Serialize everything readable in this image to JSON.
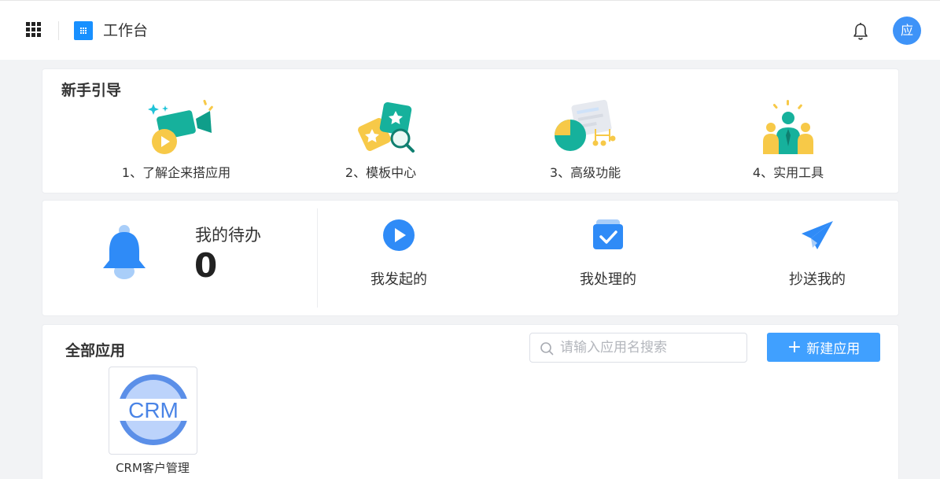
{
  "topbar": {
    "title": "工作台",
    "avatar_text": "应",
    "icons": [
      "apps-grid-icon",
      "workspace-logo-icon",
      "notification-bell-icon"
    ]
  },
  "guide": {
    "title": "新手引导",
    "items": [
      {
        "label": "1、了解企来搭应用",
        "icon": "video-camera-illustration"
      },
      {
        "label": "2、模板中心",
        "icon": "template-cards-illustration"
      },
      {
        "label": "3、高级功能",
        "icon": "chart-flow-illustration"
      },
      {
        "label": "4、实用工具",
        "icon": "team-people-illustration"
      }
    ]
  },
  "todo": {
    "title": "我的待办",
    "count": "0",
    "actions": [
      {
        "label": "我发起的",
        "icon": "play-circle-icon"
      },
      {
        "label": "我处理的",
        "icon": "checked-box-icon"
      },
      {
        "label": "抄送我的",
        "icon": "paper-plane-icon"
      }
    ]
  },
  "apps": {
    "title": "全部应用",
    "search_placeholder": "请输入应用名搜索",
    "new_button_label": "新建应用",
    "items": [
      {
        "name": "CRM客户管理",
        "logo_text": "CRM"
      }
    ]
  },
  "colors": {
    "primary": "#40a0ff",
    "accent_teal": "#16b19c",
    "accent_yellow": "#f7c948",
    "icon_blue": "#2f8bf7"
  }
}
